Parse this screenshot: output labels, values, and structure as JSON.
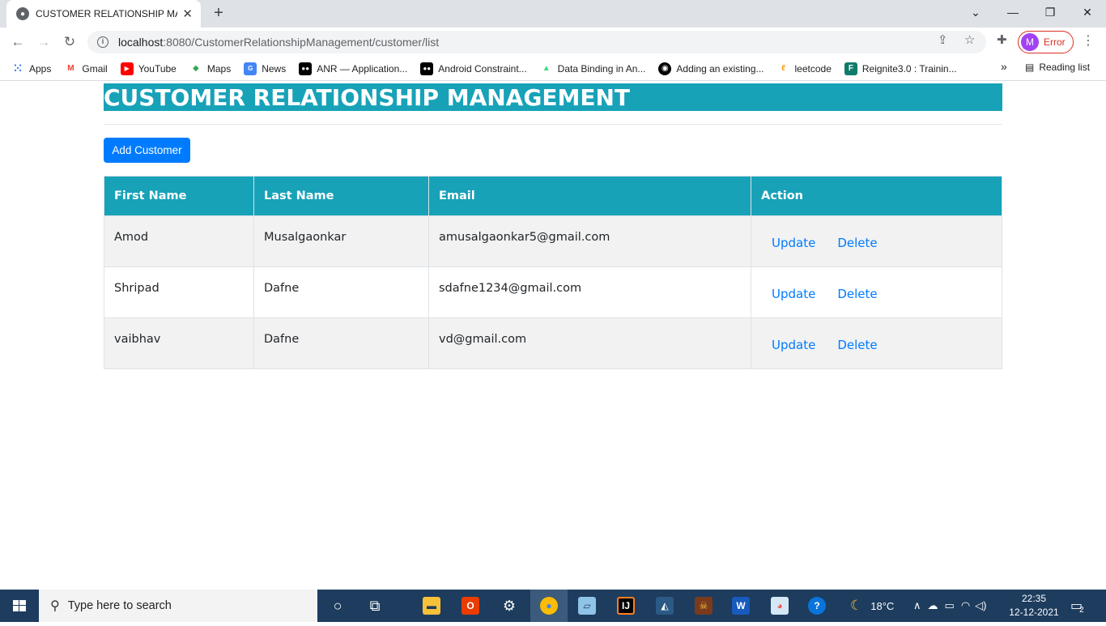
{
  "browser": {
    "tab_title": "CUSTOMER RELATIONSHIP MAN",
    "url_host": "localhost",
    "url_rest": ":8080/CustomerRelationshipManagement/customer/list",
    "profile_initial": "M",
    "profile_status": "Error",
    "bookmarks": [
      "Apps",
      "Gmail",
      "YouTube",
      "Maps",
      "News",
      "ANR — Application...",
      "Android Constraint...",
      "Data Binding in An...",
      "Adding an existing...",
      "leetcode",
      "Reignite3.0 : Trainin..."
    ],
    "overflow_label": "»",
    "reading_list": "Reading list"
  },
  "page": {
    "header": "CUSTOMER RELATIONSHIP MANAGEMENT",
    "add_button": "Add Customer",
    "columns": [
      "First Name",
      "Last Name",
      "Email",
      "Action"
    ],
    "rows": [
      {
        "first": "Amod",
        "last": "Musalgaonkar",
        "email": "amusalgaonkar5@gmail.com",
        "update": "Update",
        "delete": "Delete"
      },
      {
        "first": "Shripad",
        "last": "Dafne",
        "email": "sdafne1234@gmail.com",
        "update": "Update",
        "delete": "Delete"
      },
      {
        "first": "vaibhav",
        "last": "Dafne",
        "email": "vd@gmail.com",
        "update": "Update",
        "delete": "Delete"
      }
    ]
  },
  "taskbar": {
    "search_placeholder": "Type here to search",
    "temperature": "18°C",
    "time": "22:35",
    "date": "12-12-2021",
    "notification_count": "2"
  },
  "colors": {
    "header_bg": "#17a2b8",
    "button_bg": "#007bff",
    "taskbar_bg": "#1d3c5e"
  }
}
